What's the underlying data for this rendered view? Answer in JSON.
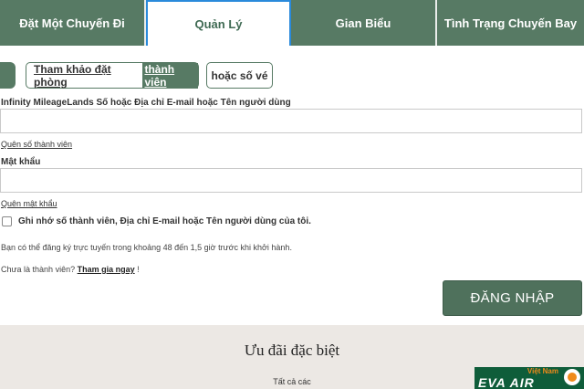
{
  "nav": {
    "tabs": [
      {
        "label": "Đặt Một Chuyến Đi"
      },
      {
        "label": "Quản Lý"
      },
      {
        "label": "Gian Biểu"
      },
      {
        "label": "Tình Trạng Chuyến Bay"
      }
    ],
    "active_tab": "Quản Lý"
  },
  "lookup": {
    "booking_prefix": "Tham khảo đặt phòng",
    "booking_highlight": "thành viên",
    "ticket_label": "hoặc số vé"
  },
  "form": {
    "member_label": "Infinity MileageLands Số hoặc Địa chỉ E-mail hoặc Tên người dùng",
    "member_value": "",
    "forgot_member": "Quên số thành viên",
    "password_label": "Mật khẩu",
    "password_value": "",
    "forgot_password": "Quên mật khẩu",
    "remember_label": "Ghi nhớ số thành viên, Địa chỉ E-mail hoặc Tên người dùng của tôi.",
    "remember_checked": false,
    "checkin_info": "Bạn có thể đăng ký trực tuyến trong khoảng 48 đến 1,5 giờ trước khi khởi hành.",
    "join_prefix": "Chưa là thành viên?",
    "join_link": "Tham gia ngay",
    "join_suffix": "!",
    "login_button": "ĐĂNG NHẬP"
  },
  "promo": {
    "title": "Ưu đãi đặc biệt",
    "subtitle": "Tất cả các"
  },
  "logo": {
    "top_text": "Việt Nam",
    "main_text": "EVA AIR",
    "brand_color": "#0f5d3a",
    "accent_color": "#f08a1a"
  },
  "colors": {
    "primary_green": "#577a64",
    "active_border": "#2a8adb"
  }
}
